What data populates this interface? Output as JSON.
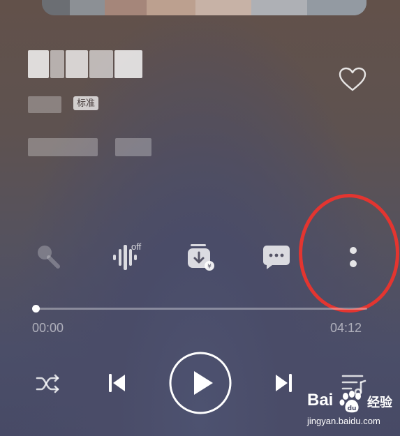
{
  "song": {
    "quality_badge": "标准"
  },
  "actions": {
    "effect_off_label": "off"
  },
  "progress": {
    "current_time": "00:00",
    "total_time": "04:12",
    "fraction": 0
  },
  "watermark": {
    "brand": "Bai",
    "brand_suffix": "经验",
    "url": "jingyan.baidu.com"
  },
  "icons": {
    "like": "heart-icon",
    "sing": "microphone-icon",
    "effect": "sound-effect-icon",
    "download": "paid-download-icon",
    "comment": "comment-icon",
    "more": "more-vertical-icon",
    "shuffle": "shuffle-icon",
    "previous": "previous-icon",
    "play": "play-icon",
    "next": "next-icon",
    "playlist": "playlist-icon"
  },
  "colors": {
    "annotation": "#e33530",
    "accent": "#ffffff"
  }
}
